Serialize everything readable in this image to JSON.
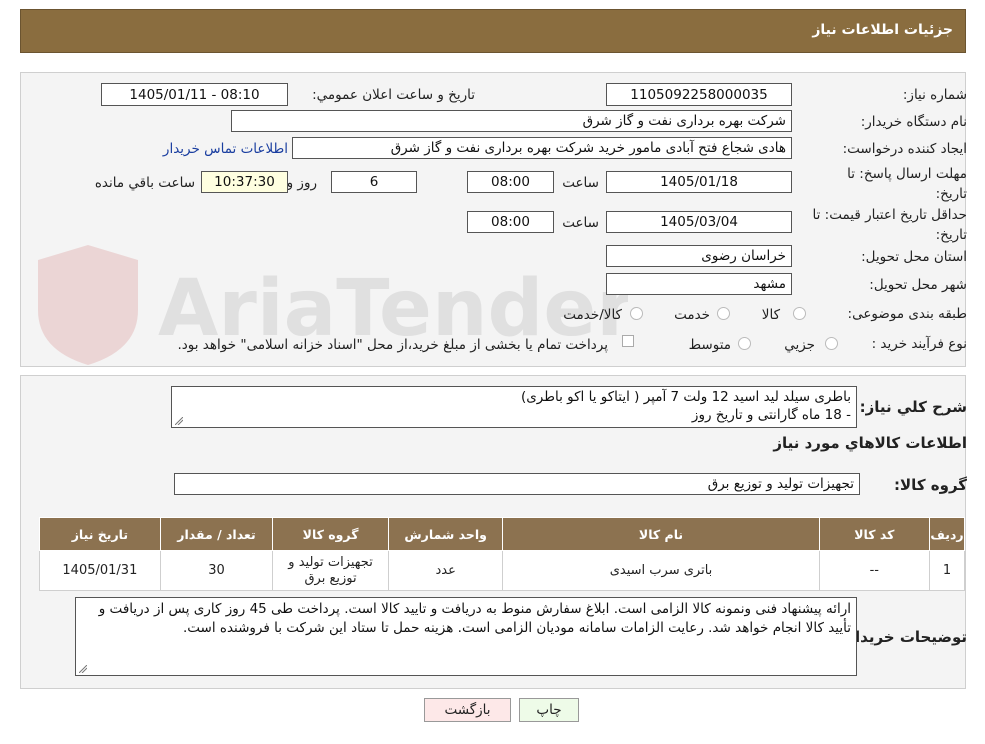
{
  "header": {
    "title": "جزئیات اطلاعات نیاز"
  },
  "form": {
    "need_number_label": "شماره نیاز:",
    "need_number": "1105092258000035",
    "announce_label": "تاریخ و ساعت اعلان عمومي:",
    "announce_value": "1405/01/11 - 08:10",
    "buyer_org_label": "نام دستگاه خريدار:",
    "buyer_org": "شرکت بهره برداری نفت و گاز شرق",
    "creator_label": "ايجاد کننده درخواست:",
    "creator": "هادی شجاع فتح آبادی مامور خرید شرکت بهره برداری نفت و گاز شرق",
    "contact_link": "اطلاعات تماس خریدار",
    "reply_deadline_label": "مهلت ارسال پاسخ: تا تاريخ:",
    "reply_date": "1405/01/18",
    "time_label": "ساعت",
    "reply_time": "08:00",
    "days": "6",
    "days_label": "روز و",
    "remaining_time": "10:37:30",
    "remaining_label": "ساعت باقي مانده",
    "validity_label": "حداقل تاريخ اعتبار قيمت: تا تاريخ:",
    "validity_date": "1405/03/04",
    "validity_time": "08:00",
    "province_label": "استان محل تحويل:",
    "province": "خراسان رضوی",
    "city_label": "شهر محل تحويل:",
    "city": "مشهد",
    "category_label": "طبقه بندی موضوعی:",
    "category_options": [
      "کالا",
      "خدمت",
      "کالا/خدمت"
    ],
    "process_label": "نوع فرآيند خريد :",
    "process_options": [
      "جزيي",
      "متوسط"
    ],
    "process_note": "پرداخت تمام يا بخشی از مبلغ خريد،از محل \"اسناد خزانه اسلامی\" خواهد بود."
  },
  "details": {
    "desc_label": "شرح کلي نياز:",
    "desc_line1": "باطری سیلد لید اسید 12 ولت 7 آمپر ( ایتاکو یا اکو باطری)",
    "desc_line2": "- 18 ماه گارانتی و تاریخ روز",
    "goods_info_title": "اطلاعات کالاهاي مورد نياز",
    "goods_group_label": "گروه کالا:",
    "goods_group": "تجهیزات تولید و توزیع برق",
    "table_headers": [
      "رديف",
      "کد کالا",
      "نام کالا",
      "واحد شمارش",
      "گروه کالا",
      "تعداد / مقدار",
      "تاريخ نياز"
    ],
    "rows": [
      {
        "row": "1",
        "code": "--",
        "name": "باتری سرب اسیدی",
        "unit": "عدد",
        "group": "تجهیزات تولید و توزیع برق",
        "qty": "30",
        "date": "1405/01/31"
      }
    ],
    "buyer_notes_label": "توضيحات خريدار:",
    "buyer_notes": "ارائه پیشنهاد فنی ونمونه کالا الزامی است. ابلاغ سفارش منوط به دریافت و تایید کالا است. پرداخت طی  45 روز کاری پس از دریافت و تأیید کالا انجام خواهد شد. رعایت الزامات سامانه مودیان الزامی است. هزینه حمل تا ستاد این شرکت با فروشنده است."
  },
  "buttons": {
    "print": "چاپ",
    "back": "بازگشت"
  },
  "watermark": {
    "text": "AriaTender.neT"
  },
  "colors": {
    "header_bg": "#8a6d3f",
    "table_header_bg": "#8c7250",
    "link": "#1a3ea0"
  }
}
